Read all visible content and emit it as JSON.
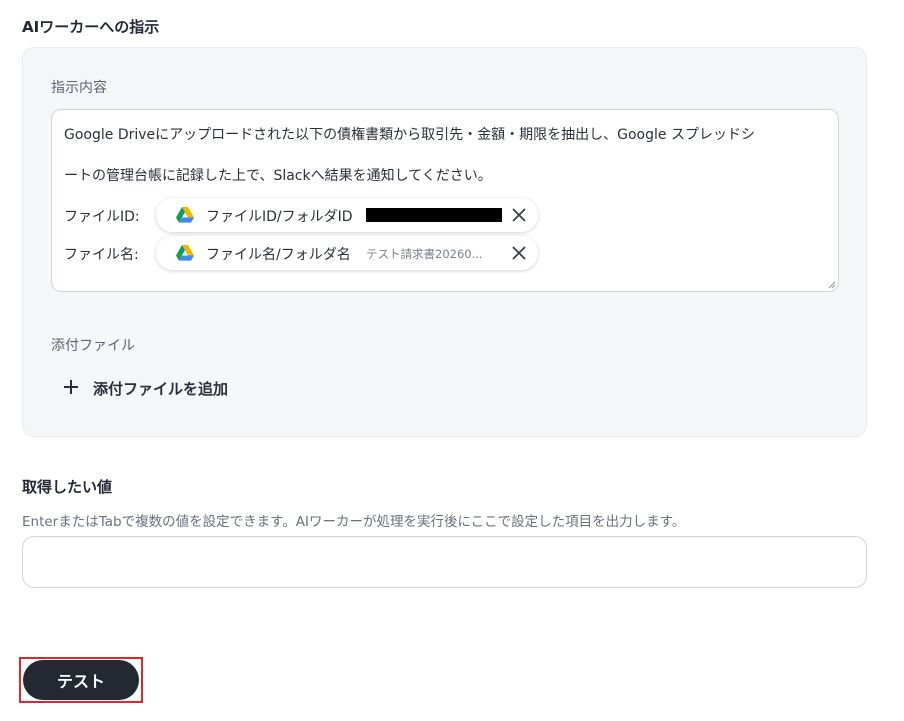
{
  "section": {
    "title": "AIワーカーへの指示"
  },
  "instruction": {
    "label": "指示内容",
    "line1": "Google Driveにアップロードされた以下の債権書類から取引先・金額・期限を抽出し、Google スプレッドシ",
    "line2": "ートの管理台帳に記録した上で、Slackへ結果を通知してください。",
    "variables": [
      {
        "label": "ファイルID:",
        "chip_title": "ファイルID/フォルダID",
        "value_redacted": true,
        "icon": "google-drive-icon"
      },
      {
        "label": "ファイル名:",
        "chip_title": "ファイル名/フォルダ名",
        "value": "テスト請求書20260...",
        "icon": "google-drive-icon"
      }
    ]
  },
  "attachments": {
    "label": "添付ファイル",
    "add_label": "添付ファイルを追加"
  },
  "values": {
    "title": "取得したい値",
    "help": "EnterまたはTabで複数の値を設定できます。AIワーカーが処理を実行後にここで設定した項目を出力します。",
    "input_value": ""
  },
  "actions": {
    "test_label": "テスト"
  },
  "colors": {
    "panel_bg": "#f5f6f8",
    "button_bg": "#232833",
    "highlight_border": "#e3262b",
    "drive_green": "#0f9d58",
    "drive_yellow": "#f4b400",
    "drive_blue": "#4285f4"
  }
}
